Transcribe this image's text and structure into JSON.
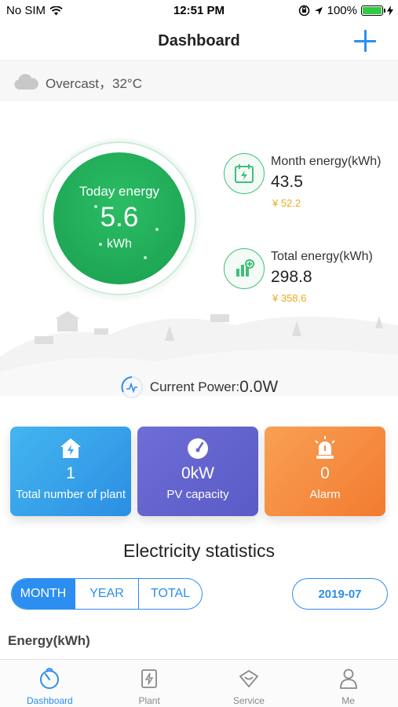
{
  "status_bar": {
    "carrier": "No SIM",
    "time": "12:51 PM",
    "battery": "100%"
  },
  "nav": {
    "title": "Dashboard",
    "add_icon": "plus-icon"
  },
  "weather": {
    "icon": "cloud-icon",
    "text": "Overcast，32°C"
  },
  "today": {
    "label": "Today energy",
    "value": "5.6",
    "unit": "kWh"
  },
  "month": {
    "label": "Month energy(kWh)",
    "value": "43.5",
    "money": "¥ 52.2"
  },
  "total": {
    "label": "Total energy(kWh)",
    "value": "298.8",
    "money": "¥ 358.6"
  },
  "current_power": {
    "label": "Current Power:",
    "value": "0.0W"
  },
  "cards": {
    "plants": {
      "value": "1",
      "label": "Total number of plant",
      "icon": "house-bolt-icon"
    },
    "pv": {
      "value": "0kW",
      "label": "PV capacity",
      "icon": "gauge-icon"
    },
    "alarm": {
      "value": "0",
      "label": "Alarm",
      "icon": "siren-icon"
    }
  },
  "statistics": {
    "title": "Electricity statistics",
    "tabs": [
      "MONTH",
      "YEAR",
      "TOTAL"
    ],
    "active_tab": "MONTH",
    "date": "2019-07",
    "energy_label": "Energy(kWh)"
  },
  "tab_bar": {
    "items": [
      {
        "label": "Dashboard",
        "icon": "dashboard-icon",
        "active": true
      },
      {
        "label": "Plant",
        "icon": "plant-icon",
        "active": false
      },
      {
        "label": "Service",
        "icon": "service-icon",
        "active": false
      },
      {
        "label": "Me",
        "icon": "person-icon",
        "active": false
      }
    ]
  },
  "colors": {
    "accent": "#2b8ef0",
    "green": "#1fa856",
    "money": "#f0a91e",
    "plants_card": "#3aa6ea",
    "pv_card": "#6665d0",
    "alarm_card": "#f58d42"
  }
}
